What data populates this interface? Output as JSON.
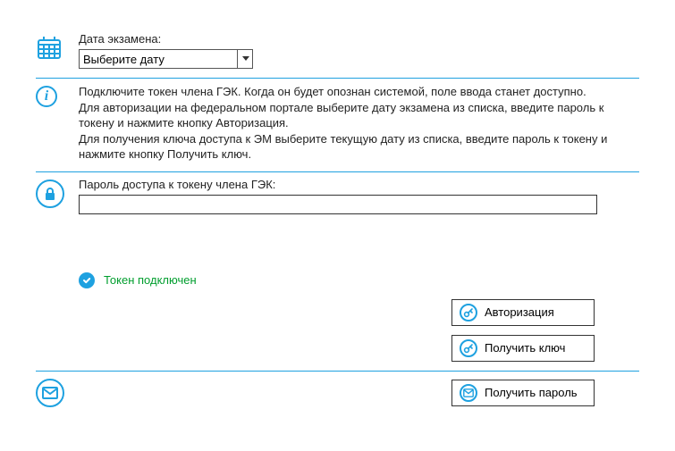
{
  "exam_date": {
    "label": "Дата экзамена:",
    "selected": "Выберите дату"
  },
  "info": {
    "line1": "Подключите токен члена ГЭК. Когда он будет опознан системой, поле ввода станет доступно.",
    "line2": "Для авторизации на федеральном портале выберите дату экзамена из списка, введите пароль к токену и нажмите кнопку Авторизация.",
    "line3": "Для получения ключа доступа к ЭМ выберите текущую дату из списка, введите пароль к токену и нажмите кнопку Получить ключ."
  },
  "password": {
    "label": "Пароль доступа к токену члена ГЭК:",
    "value": ""
  },
  "status": {
    "token_connected": "Токен подключен"
  },
  "buttons": {
    "auth": "Авторизация",
    "get_key": "Получить ключ",
    "get_password": "Получить пароль"
  },
  "colors": {
    "accent": "#1ea1e0",
    "success": "#009e2e"
  }
}
